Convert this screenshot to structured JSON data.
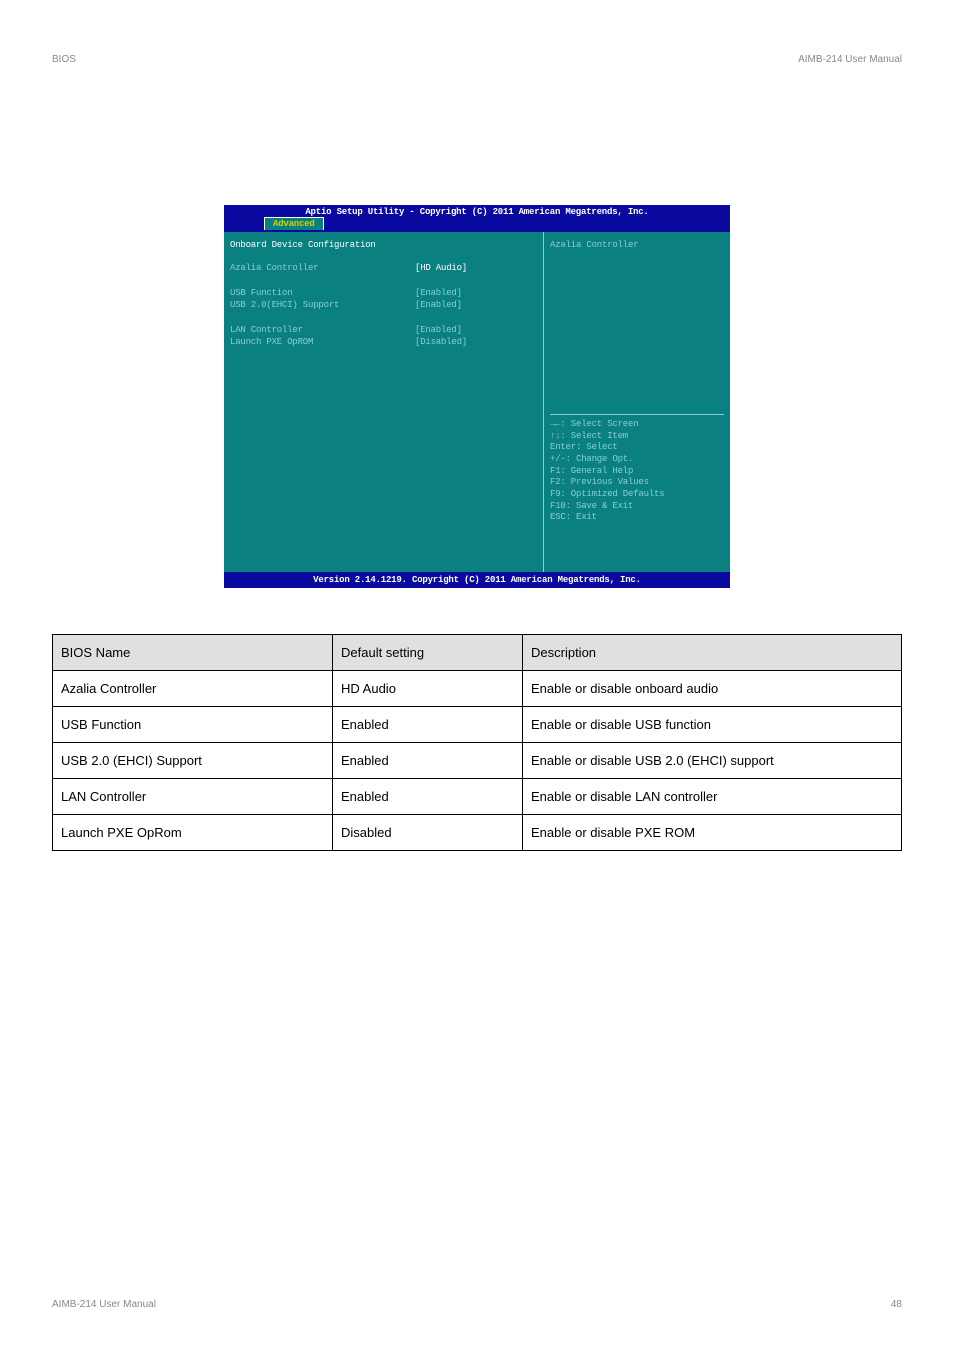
{
  "page_header": {
    "left": "BIOS",
    "right": "AIMB-214 User Manual"
  },
  "bios": {
    "title_bar": "Aptio Setup Utility - Copyright (C) 2011 American Megatrends, Inc.",
    "tab": "Advanced",
    "section_title": "Onboard Device Configuration",
    "rows": [
      {
        "label": "Azalia Controller",
        "value": "[HD Audio]",
        "white": true
      },
      {
        "gap": true
      },
      {
        "label": "USB Function",
        "value": "[Enabled]"
      },
      {
        "label": "USB 2.0(EHCI) Support",
        "value": "[Enabled]"
      },
      {
        "gap": true
      },
      {
        "label": "LAN Controller",
        "value": "[Enabled]"
      },
      {
        "label": "Launch PXE OpROM",
        "value": "[Disabled]"
      }
    ],
    "help_title": "Azalia Controller",
    "help_keys": "→←: Select Screen\n↑↓: Select Item\nEnter: Select\n+/-: Change Opt.\nF1: General Help\nF2: Previous Values\nF9: Optimized Defaults\nF10: Save & Exit\nESC: Exit",
    "footer": "Version 2.14.1219. Copyright (C) 2011 American Megatrends, Inc."
  },
  "config_table": {
    "headers": [
      "BIOS Name",
      "Default setting",
      "Description"
    ],
    "rows": [
      {
        "name": "Azalia Controller",
        "default": "HD Audio",
        "desc": "Enable or disable onboard audio"
      },
      {
        "name": "USB Function",
        "default": "Enabled",
        "desc": "Enable or disable USB function"
      },
      {
        "name": "USB 2.0 (EHCI) Support",
        "default": "Enabled",
        "desc": "Enable or disable USB 2.0 (EHCI) support"
      },
      {
        "name": "LAN Controller",
        "default": "Enabled",
        "desc": "Enable or disable LAN controller"
      },
      {
        "name": "Launch PXE OpRom",
        "default": "Disabled",
        "desc": "Enable or disable PXE ROM"
      }
    ]
  },
  "page_footer": {
    "left": "AIMB-214 User Manual",
    "right": "48"
  }
}
